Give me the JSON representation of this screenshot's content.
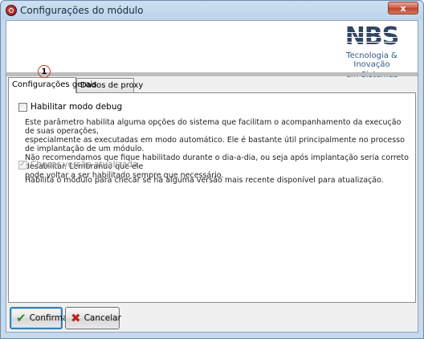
{
  "window": {
    "title": "Configurações do módulo",
    "close_label": "x"
  },
  "logo": {
    "mark": "NBS",
    "tagline_line1": "Tecnologia & Inovação",
    "tagline_line2": "em Sistemas",
    "brand_color": "#2f4564",
    "tagline_color": "#2e5a8c"
  },
  "annotation": {
    "badge": "1"
  },
  "tabs": [
    {
      "label": "Configurações gerais",
      "active": true
    },
    {
      "label": "Dados de proxy",
      "active": false
    }
  ],
  "options": {
    "debug": {
      "label": "Habilitar modo debug",
      "checked": false,
      "description": [
        "Este parâmetro habilita alguma opções do sistema que facilitam o acompanhamento da execução de suas operações,",
        "especialmente as executadas em modo automático. Ele é bastante útil principalmente no processo de implantação de um módulo.",
        "Não recomendamos que fique habilitado durante o dia-a-dia, ou seja após implantação seria correto desabilitar. Lembrando que ele",
        "pode voltar a ser habilitado sempre que necessário."
      ]
    },
    "check_version": {
      "label": "Checar versão atualizada",
      "checked": true,
      "disabled": true,
      "description": [
        "Habilita o módulo para checar se há alguma versão mais recente disponível para atualização."
      ]
    }
  },
  "buttons": {
    "confirm_label": "Confirmar",
    "cancel_label": "Cancelar"
  }
}
